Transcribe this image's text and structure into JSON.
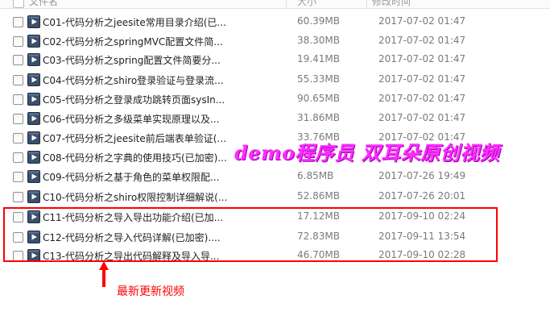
{
  "columns": {
    "name": "文件名",
    "size": "大小",
    "modified": "修改时间"
  },
  "rows": [
    {
      "name": "C01-代码分析之jeesite常用目录介绍(已...",
      "size": "60.39MB",
      "date": "2017-07-02 01:47"
    },
    {
      "name": "C02-代码分析之springMVC配置文件简...",
      "size": "38.30MB",
      "date": "2017-07-02 01:47"
    },
    {
      "name": "C03-代码分析之spring配置文件简要分...",
      "size": "19.41MB",
      "date": "2017-07-02 01:47"
    },
    {
      "name": "C04-代码分析之shiro登录验证与登录流...",
      "size": "55.33MB",
      "date": "2017-07-02 01:47"
    },
    {
      "name": "C05-代码分析之登录成功跳转页面sysIn...",
      "size": "90.65MB",
      "date": "2017-07-02 01:47"
    },
    {
      "name": "C06-代码分析之多级菜单实现原理以及...",
      "size": "31.86MB",
      "date": "2017-07-02 01:47"
    },
    {
      "name": "C07-代码分析之jeesite前后端表单验证(...",
      "size": "33.76MB",
      "date": "2017-07-02 01:47"
    },
    {
      "name": "C08-代码分析之字典的使用技巧(已加密)...",
      "size": "",
      "date": ""
    },
    {
      "name": "C09-代码分析之基于角色的菜单权限配...",
      "size": "6.85MB",
      "date": "2017-07-26 19:49"
    },
    {
      "name": "C10-代码分析之shiro权限控制详细解说(...",
      "size": "52.86MB",
      "date": "2017-07-26 20:01"
    },
    {
      "name": "C11-代码分析之导入导出功能介绍(已加...",
      "size": "17.12MB",
      "date": "2017-09-10 02:24"
    },
    {
      "name": "C12-代码分析之导入代码详解(已加密)....",
      "size": "72.83MB",
      "date": "2017-09-11 13:54"
    },
    {
      "name": "C13-代码分析之导出代码解释及导入导...",
      "size": "46.70MB",
      "date": "2017-09-10 02:28"
    }
  ],
  "watermark": "demo程序员 双耳朵原创视频",
  "annotation": {
    "note": "最新更新视频",
    "highlight_color": "#ff0000"
  },
  "icons": {
    "file": "video-file-icon",
    "arrow": "arrow-up-icon"
  },
  "colors": {
    "watermark": "#ff2cff",
    "text_secondary": "#7a7a7a"
  }
}
